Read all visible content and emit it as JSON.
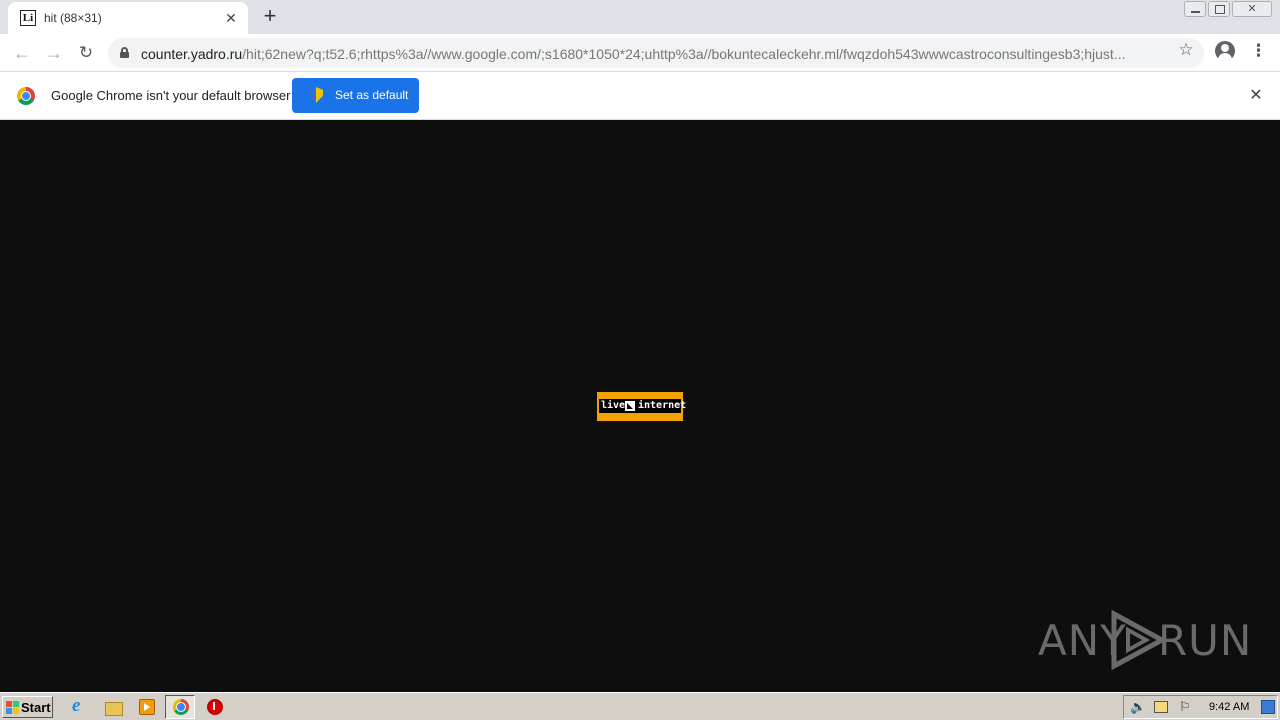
{
  "browser": {
    "tab": {
      "favicon_text": "Li",
      "title": "hit (88×31)",
      "close_glyph": "✕"
    },
    "new_tab_glyph": "+",
    "nav": {
      "back_glyph": "←",
      "forward_glyph": "→",
      "reload_glyph": "↻"
    },
    "address": {
      "host": "counter.yadro.ru",
      "path": "/hit;62new?q;t52.6;rhttps%3a//www.google.com/;s1680*1050*24;uhttp%3a//bokuntecaleckehr.ml/fwqzdoh543wwwcastroconsultingesb3;hjust..."
    },
    "star_glyph": "☆",
    "menu_glyph": "⋮"
  },
  "infobar": {
    "message": "Google Chrome isn't your default browser",
    "button_label": "Set as default",
    "close_glyph": "✕"
  },
  "content": {
    "counter": {
      "left_text": "live",
      "right_text": "internet",
      "colors": {
        "frame": "#f4a200",
        "inner": "#000000"
      }
    },
    "watermark": {
      "left": "ANY",
      "right": "RUN"
    },
    "background_color": "#0e0e0e"
  },
  "taskbar": {
    "start_label": "Start",
    "clock": "9:42 AM",
    "icons": [
      "ie-icon",
      "explorer-icon",
      "media-player-icon",
      "chrome-icon",
      "opera-icon"
    ]
  }
}
